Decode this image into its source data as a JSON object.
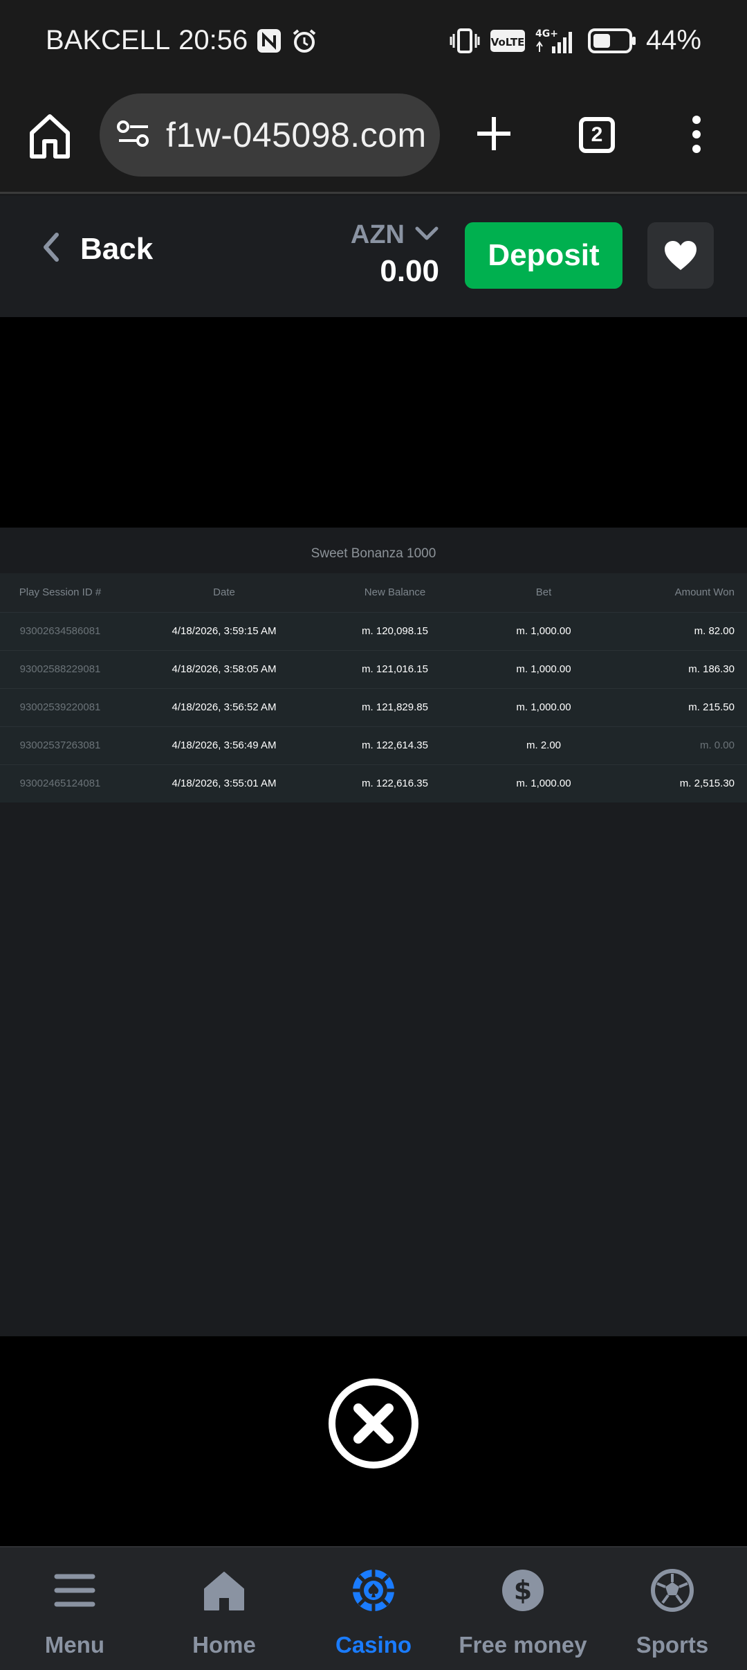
{
  "status_bar": {
    "carrier": "BAKCELL",
    "time": "20:56",
    "network_badge": "VoLTE",
    "network_type": "4G+",
    "battery": "44%"
  },
  "browser": {
    "url": "f1w-045098.com",
    "tab_count": "2"
  },
  "header": {
    "back_label": "Back",
    "currency": "AZN",
    "balance": "0.00",
    "deposit_label": "Deposit"
  },
  "history": {
    "title": "Sweet Bonanza 1000",
    "columns": [
      "Play Session ID #",
      "Date",
      "New Balance",
      "Bet",
      "Amount Won"
    ],
    "rows": [
      [
        "93002634586081",
        "4/18/2026, 3:59:15 AM",
        "m. 120,098.15",
        "m. 1,000.00",
        "m. 82.00"
      ],
      [
        "93002588229081",
        "4/18/2026, 3:58:05 AM",
        "m. 121,016.15",
        "m. 1,000.00",
        "m. 186.30"
      ],
      [
        "93002539220081",
        "4/18/2026, 3:56:52 AM",
        "m. 121,829.85",
        "m. 1,000.00",
        "m. 215.50"
      ],
      [
        "93002537263081",
        "4/18/2026, 3:56:49 AM",
        "m. 122,614.35",
        "m. 2.00",
        "m. 0.00"
      ],
      [
        "93002465124081",
        "4/18/2026, 3:55:01 AM",
        "m. 122,616.35",
        "m. 1,000.00",
        "m. 2,515.30"
      ]
    ]
  },
  "nav": {
    "items": [
      {
        "label": "Menu",
        "icon": "menu-icon"
      },
      {
        "label": "Home",
        "icon": "home-icon"
      },
      {
        "label": "Casino",
        "icon": "casino-chip-icon",
        "active": true
      },
      {
        "label": "Free money",
        "icon": "dollar-coin-icon"
      },
      {
        "label": "Sports",
        "icon": "soccer-ball-icon"
      }
    ]
  },
  "colors": {
    "deposit": "#00b04f",
    "active_nav": "#1a7cff",
    "muted_text": "#8a93a2"
  }
}
